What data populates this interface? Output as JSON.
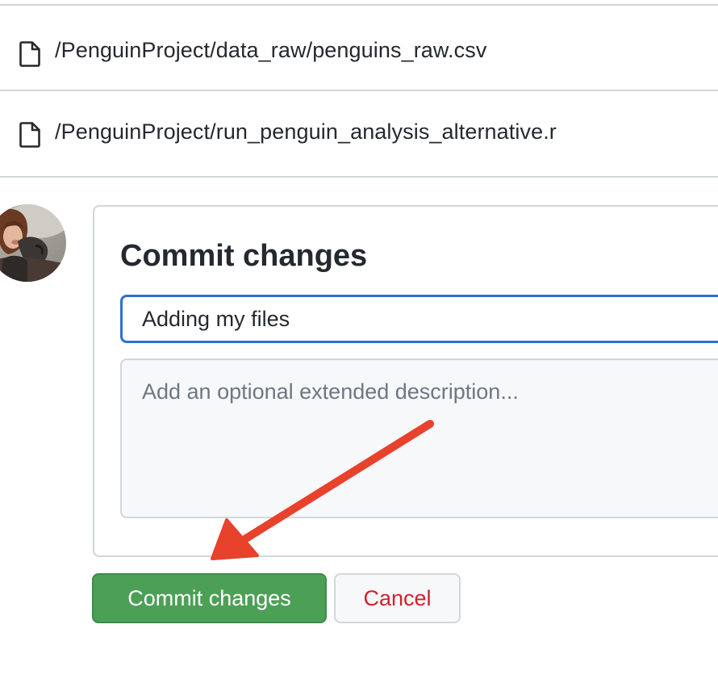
{
  "files": [
    {
      "path": "/PenguinProject/data_raw/penguins_raw.csv",
      "icon": "file-icon"
    },
    {
      "path": "/PenguinProject/run_penguin_analysis_alternative.r",
      "icon": "file-icon"
    }
  ],
  "commit_form": {
    "title": "Commit changes",
    "summary_value": "Adding my files",
    "description_placeholder": "Add an optional extended description..."
  },
  "buttons": {
    "commit_label": "Commit changes",
    "cancel_label": "Cancel"
  },
  "colors": {
    "commit_button": "#4ca056",
    "cancel_text": "#cf222e",
    "focus_border": "#2f6fd6",
    "annotation_arrow": "#e8412c"
  },
  "annotation": {
    "type": "arrow",
    "points_to": "commit-button"
  }
}
